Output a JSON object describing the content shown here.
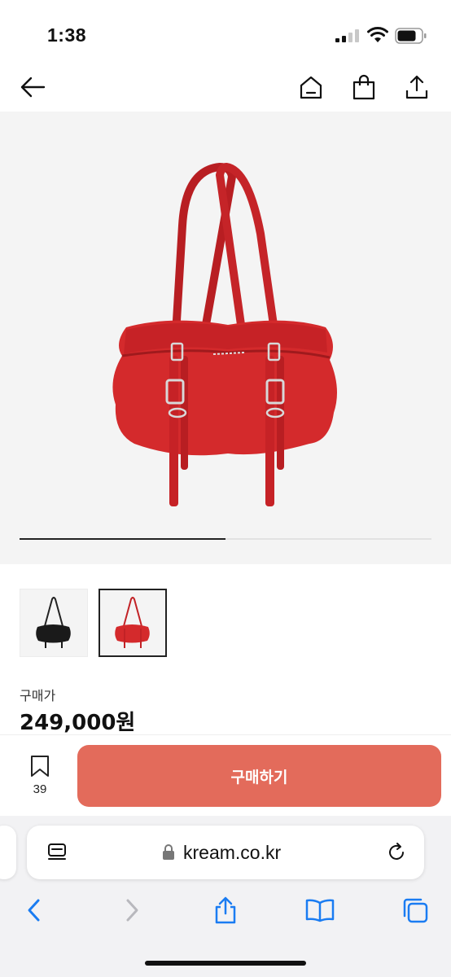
{
  "status_bar": {
    "time": "1:38"
  },
  "product": {
    "thumbnail_progress_percent": 50,
    "thumbnails": [
      "black",
      "red"
    ],
    "selected_thumbnail": "red",
    "price_label": "구매가",
    "price": "249,000원"
  },
  "action_bar": {
    "bookmark_count": "39",
    "buy_label": "구매하기",
    "buy_color": "#e36b5b"
  },
  "browser": {
    "url": "kream.co.kr"
  },
  "icons": [
    "back-arrow-icon",
    "home-icon",
    "shopping-bag-icon",
    "share-icon",
    "bookmark-icon",
    "reader-icon",
    "lock-icon",
    "reload-icon",
    "chevron-left-icon",
    "chevron-right-icon",
    "share-icon",
    "book-icon",
    "tabs-icon"
  ]
}
